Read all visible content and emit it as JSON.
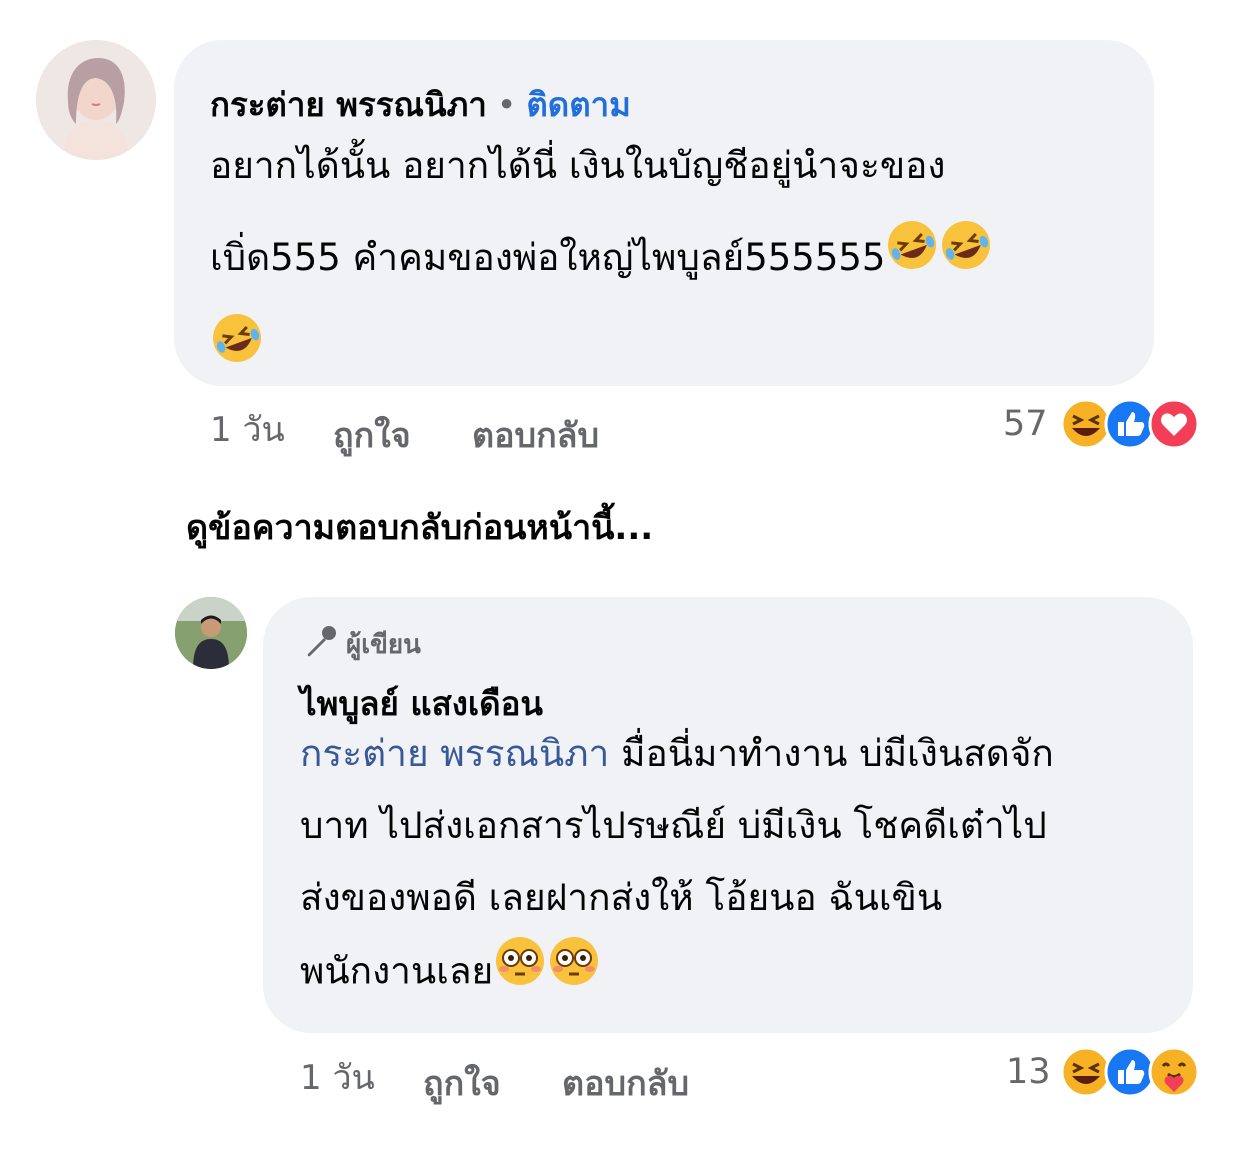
{
  "comment1": {
    "author": "กระต่าย พรรณนิภา",
    "separator": "•",
    "follow_label": "ติดตาม",
    "lines": [
      "อยากได้นั้น อยากได้นี่ เงินในบัญชีอยู่นำจะของ",
      "เบิ่ด555 คำคมของพ่อใหญ่ไพบูลย์555555"
    ],
    "emoji": "rolling-on-floor-laughing",
    "time": "1 วัน",
    "like_label": "ถูกใจ",
    "reply_label": "ตอบกลับ",
    "reaction_count": "57",
    "reactions": [
      "haha-icon",
      "like-icon",
      "love-icon"
    ]
  },
  "view_previous": "ดูข้อความตอบกลับก่อนหน้านี้...",
  "reply1": {
    "badge": "ผู้เขียน",
    "author": "ไพบูลย์ แสงเดือน",
    "mention": "กระต่าย พรรณนิภา",
    "line1_rest": "มื่อนี่มาทำงาน บ่มีเงินสดจัก",
    "line2": "บาท ไปส่งเอกสารไปรษณีย์ บ่มีเงิน โชคดีเต๋าไป",
    "line3": "ส่งของพอดี เลยฝากส่งให้ โอ้ยนอ ฉันเขิน",
    "line4": "พนักงานเลย",
    "emoji": "flushed-face",
    "time": "1 วัน",
    "like_label": "ถูกใจ",
    "reply_label": "ตอบกลับ",
    "reaction_count": "13",
    "reactions": [
      "haha-icon",
      "like-icon",
      "care-icon"
    ]
  },
  "colors": {
    "bubble": "#f0f2f5",
    "follow": "#216fdb",
    "mention": "#385898",
    "meta": "#65676b",
    "like": "#1877f2",
    "love": "#f33e58",
    "haha": "#f7b125"
  }
}
